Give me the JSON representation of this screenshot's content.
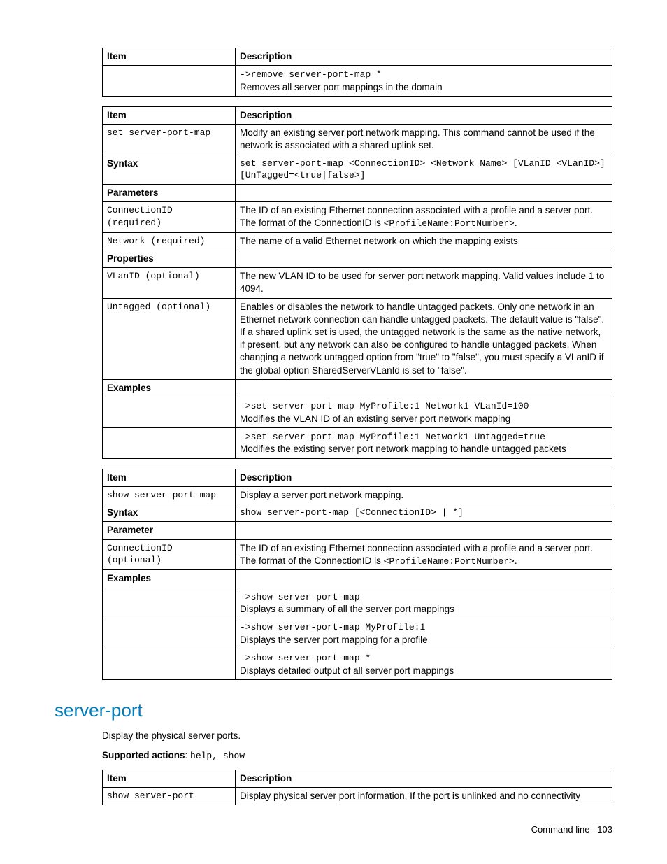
{
  "table1": {
    "headers": {
      "item": "Item",
      "desc": "Description"
    },
    "rows": [
      {
        "item": "",
        "code": "->remove server-port-map *",
        "desc": "Removes all server port mappings in the domain"
      }
    ]
  },
  "table2": {
    "headers": {
      "item": "Item",
      "desc": "Description"
    },
    "rows": {
      "cmd": {
        "item": "set server-port-map",
        "desc": "Modify an existing server port network mapping. This command cannot be used if the network is associated with a shared uplink set."
      },
      "syntax": {
        "label": "Syntax",
        "code": "set server-port-map <ConnectionID> <Network Name> [VLanID=<VLanID>] [UnTagged=<true|false>]"
      },
      "params_label": "Parameters",
      "p_conn": {
        "item": "ConnectionID (required)",
        "desc_a": "The ID of an existing Ethernet connection associated with a profile and a server port. The format of the ConnectionID is ",
        "desc_code": "<ProfileName:PortNumber>",
        "desc_b": "."
      },
      "p_net": {
        "item": "Network (required)",
        "desc": "The name of a valid Ethernet network on which the mapping exists"
      },
      "props_label": "Properties",
      "p_vlan": {
        "item": "VLanID (optional)",
        "desc": "The new VLAN ID to be used for server port network mapping. Valid values include 1 to 4094."
      },
      "p_untag": {
        "item": "Untagged (optional)",
        "desc": "Enables or disables the network to handle untagged packets. Only one network in an Ethernet network connection can handle untagged packets. The default value is \"false\". If a shared uplink set is used, the untagged network is the same as the native network, if present, but any network can also be configured to handle untagged packets. When changing a network untagged option from \"true\" to \"false\", you must specify a VLanID if the global option SharedServerVLanId is set to \"false\"."
      },
      "ex_label": "Examples",
      "ex1": {
        "code": "->set server-port-map MyProfile:1 Network1 VLanId=100",
        "desc": "Modifies the VLAN ID of an existing server port network mapping"
      },
      "ex2": {
        "code": "->set server-port-map MyProfile:1 Network1 Untagged=true",
        "desc": "Modifies the existing server port network mapping to handle untagged packets"
      }
    }
  },
  "table3": {
    "headers": {
      "item": "Item",
      "desc": "Description"
    },
    "rows": {
      "cmd": {
        "item": "show server-port-map",
        "desc": "Display a server port network mapping."
      },
      "syntax": {
        "label": "Syntax",
        "code": "show server-port-map [<ConnectionID> | *]"
      },
      "param_label": "Parameter",
      "p_conn": {
        "item": "ConnectionID (optional)",
        "desc_a": "The ID of an existing Ethernet connection associated with a profile and a server port. The format of the ConnectionID is ",
        "desc_code": "<ProfileName:PortNumber>",
        "desc_b": "."
      },
      "ex_label": "Examples",
      "ex1": {
        "code": "->show server-port-map",
        "desc": "Displays a summary of all the server port mappings"
      },
      "ex2": {
        "code": "->show server-port-map MyProfile:1",
        "desc": "Displays the server port mapping for a profile"
      },
      "ex3": {
        "code": "->show server-port-map *",
        "desc": "Displays detailed output of all server port mappings"
      }
    }
  },
  "section": {
    "title": "server-port",
    "intro": "Display the physical server ports.",
    "supported_label": "Supported actions",
    "supported_sep": ": ",
    "supported_actions": "help, show"
  },
  "table4": {
    "headers": {
      "item": "Item",
      "desc": "Description"
    },
    "rows": {
      "cmd": {
        "item": "show server-port",
        "desc": "Display physical server port information. If the port is unlinked and no connectivity"
      }
    }
  },
  "footer": {
    "label": "Command line",
    "page": "103"
  }
}
